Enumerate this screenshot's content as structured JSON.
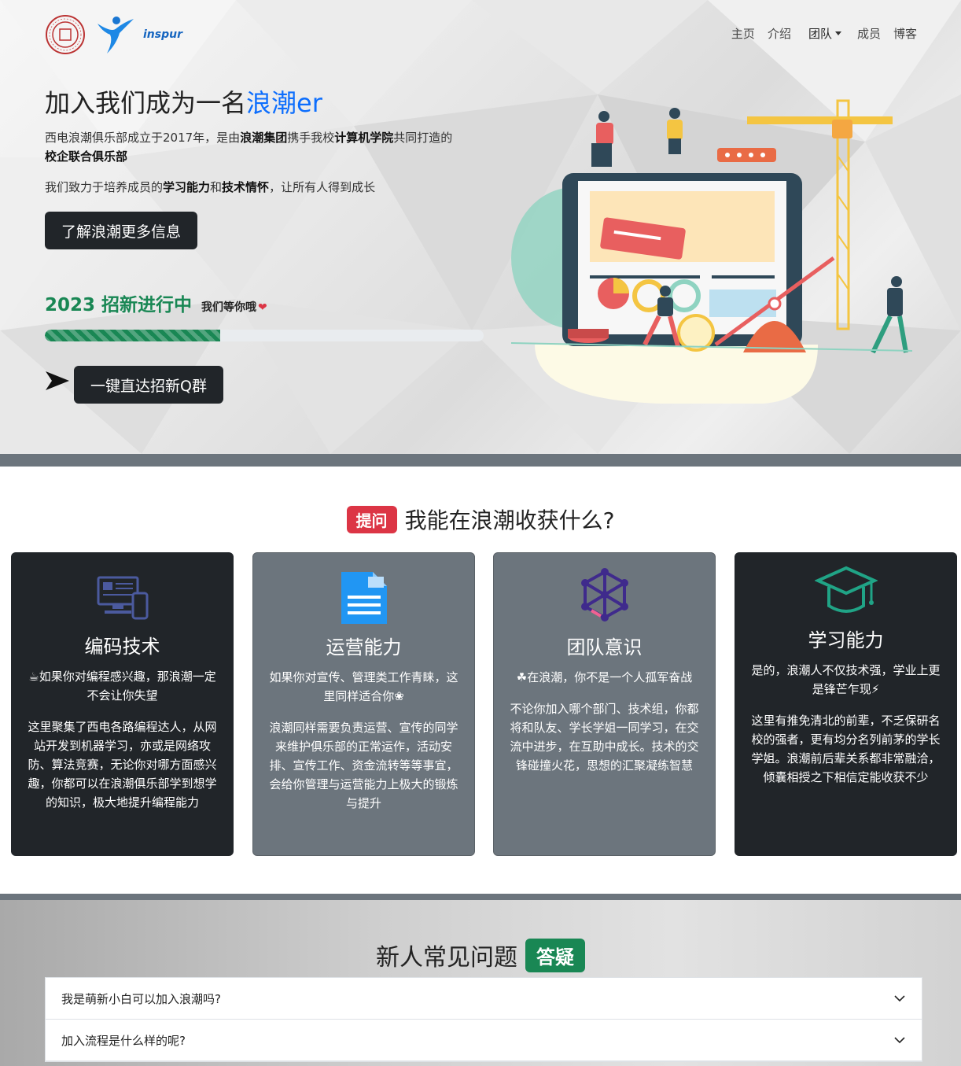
{
  "nav": {
    "items": [
      {
        "label": "主页"
      },
      {
        "label": "介绍"
      },
      {
        "label": "团队"
      },
      {
        "label": "成员"
      },
      {
        "label": "博客"
      }
    ]
  },
  "logos": {
    "brand_text": "inspur"
  },
  "hero": {
    "title_prefix": "加入我们成为一名",
    "title_highlight": "浪潮er",
    "intro_1a": "西电浪潮俱乐部成立于2017年，是由",
    "intro_1b": "浪潮集团",
    "intro_1c": "携手我校",
    "intro_1d": "计算机学院",
    "intro_1e": "共同打造的",
    "intro_1f": "校企联合俱乐部",
    "intro_2a": "我们致力于培养成员的",
    "intro_2b": "学习能力",
    "intro_2c": "和",
    "intro_2d": "技术情怀",
    "intro_2e": "，让所有人得到成长",
    "more_button": "了解浪潮更多信息",
    "recruit_title": "2023 招新进行中",
    "recruit_sub": "我们等你哦",
    "recruit_heart": "❤",
    "progress_percent": 40,
    "qq_button": "一键直达招新Q群"
  },
  "section2": {
    "badge": "提问",
    "title": "我能在浪潮收获什么?",
    "cards": [
      {
        "title": "编码技术",
        "lead": "☕如果你对编程感兴趣，那浪潮一定不会让你失望",
        "body": "这里聚集了西电各路编程达人，从网站开发到机器学习，亦或是网络攻防、算法竞赛，无论你对哪方面感兴趣，你都可以在浪潮俱乐部学到想学的知识，极大地提升编程能力"
      },
      {
        "title": "运营能力",
        "lead": "如果你对宣传、管理类工作青睐，这里同样适合你❀",
        "body": "浪潮同样需要负责运营、宣传的同学来维护俱乐部的正常运作，活动安排、宣传工作、资金流转等等事宜，会给你管理与运营能力上极大的锻炼与提升"
      },
      {
        "title": "团队意识",
        "lead": "☘在浪潮，你不是一个人孤军奋战",
        "body": "不论你加入哪个部门、技术组，你都将和队友、学长学姐一同学习，在交流中进步，在互助中成长。技术的交锋碰撞火花，思想的汇聚凝练智慧"
      },
      {
        "title": "学习能力",
        "lead": "是的，浪潮人不仅技术强，学业上更是锋芒乍现⚡",
        "body": "这里有推免清北的前辈，不乏保研名校的强者，更有均分名列前茅的学长学姐。浪潮前后辈关系都非常融洽，倾囊相授之下相信定能收获不少"
      }
    ]
  },
  "section3": {
    "title": "新人常见问题",
    "badge": "答疑",
    "questions": [
      {
        "q": "我是萌新小白可以加入浪潮吗?"
      },
      {
        "q": "加入流程是什么样的呢?"
      }
    ]
  },
  "colors": {
    "primary": "#0d6efd",
    "success": "#198754",
    "danger": "#dc3545",
    "dark": "#212529",
    "secondary": "#6c757d"
  }
}
